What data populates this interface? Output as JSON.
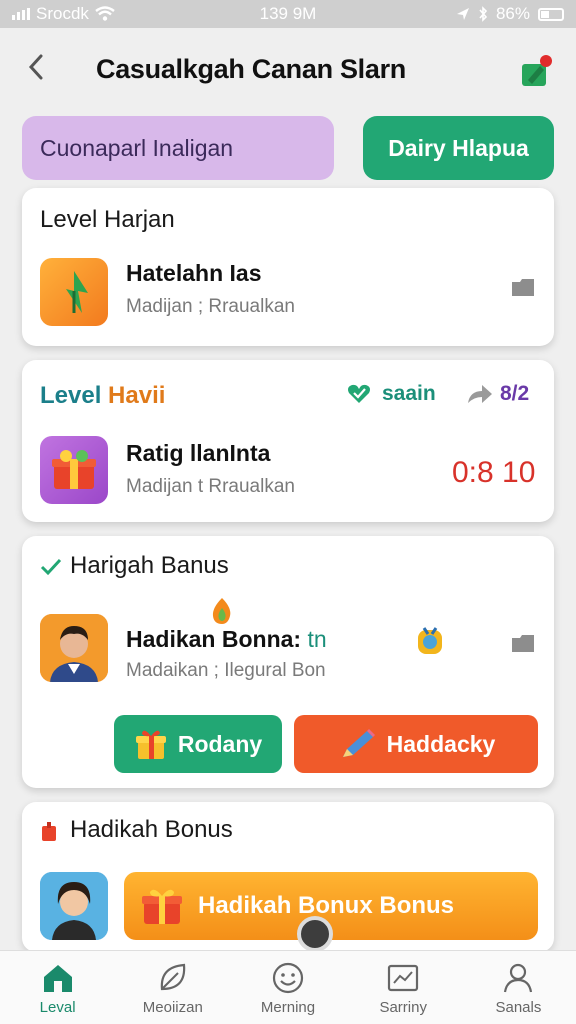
{
  "status_bar": {
    "carrier": "Srocdk",
    "time": "139 9M",
    "battery": "86%"
  },
  "header": {
    "title": "Casualkgah Canan Slarn",
    "back_icon": "chevron-left-icon",
    "action_icon": "edit-badge-icon"
  },
  "tabs": [
    {
      "label": "Cuonaparl Inaligan"
    },
    {
      "label": "Dairy Hlapua"
    }
  ],
  "card1": {
    "title": "Level Harjan",
    "item": {
      "title": "Hatelahn Ias",
      "subtitle": "Madijan ; Rraualkan"
    }
  },
  "card2": {
    "title_part1": "Level",
    "title_part2": "Havii",
    "status_label": "saain",
    "share_count": "8/2",
    "item": {
      "title": "Ratig llanInta",
      "subtitle": "Madijan t Rraualkan",
      "timer": "0:8 10"
    }
  },
  "card3": {
    "title": "Harigah Banus",
    "item": {
      "title": "Hadikan Bonna:",
      "title_suffix": "tn",
      "subtitle": "Madaikan ; Ilegural Bon"
    },
    "buttons": [
      {
        "label": "Rodany"
      },
      {
        "label": "Haddacky"
      }
    ]
  },
  "card4": {
    "title": "Hadikah Bonus",
    "banner_label": "Hadikah Bonux Bonus"
  },
  "bottom_nav": [
    {
      "label": "Leval",
      "icon": "home-icon",
      "active": true
    },
    {
      "label": "Meoiizan",
      "icon": "leaf-icon",
      "active": false
    },
    {
      "label": "Merning",
      "icon": "smiley-icon",
      "active": false
    },
    {
      "label": "Sarriny",
      "icon": "chart-card-icon",
      "active": false
    },
    {
      "label": "Sanals",
      "icon": "user-icon",
      "active": false
    }
  ],
  "colors": {
    "accent_green": "#22a774",
    "accent_orange": "#f05a2a",
    "tab_purple": "#d8b8ea",
    "timer_red": "#d8322a",
    "teal_text": "#1b7f8a"
  }
}
